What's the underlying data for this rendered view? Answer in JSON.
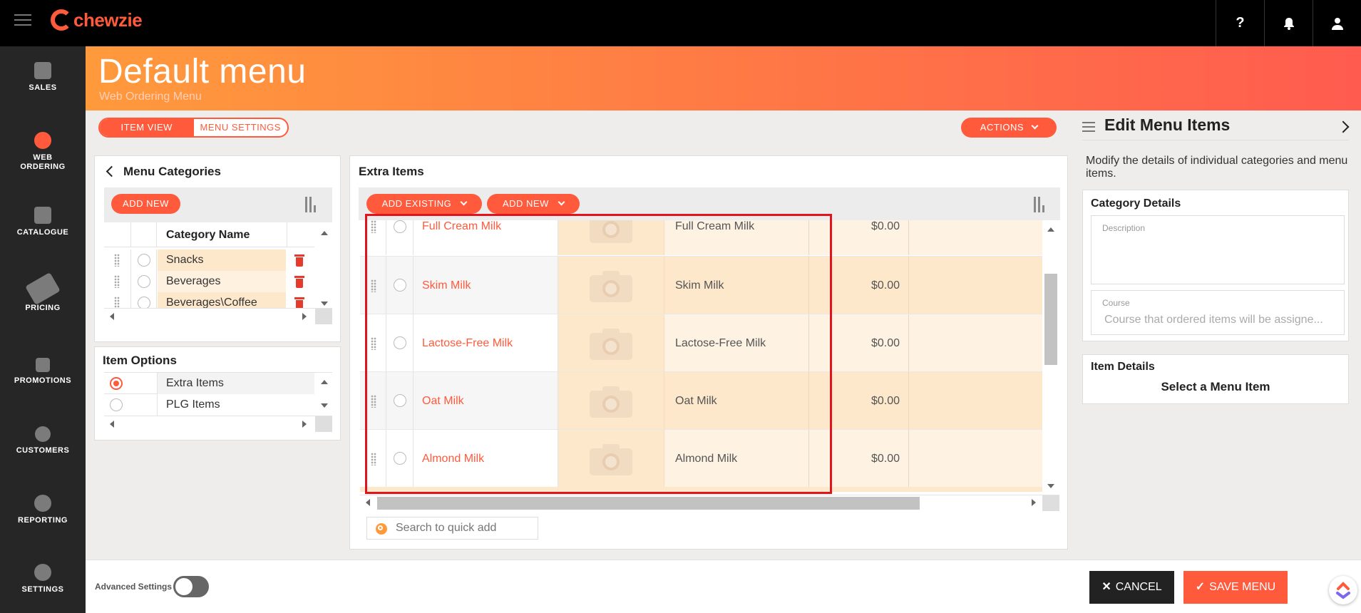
{
  "app": {
    "logo_text": "chewzie"
  },
  "topbar": {
    "help_icon": "?",
    "bell_icon": "bell-icon",
    "user_icon": "user-icon"
  },
  "nav": {
    "items": [
      {
        "label": "SALES",
        "icon": "sales-icon"
      },
      {
        "label": "WEB ORDERING",
        "icon": "globe-icon"
      },
      {
        "label": "CATALOGUE",
        "icon": "book-icon"
      },
      {
        "label": "PRICING",
        "icon": "tag-icon"
      },
      {
        "label": "PROMOTIONS",
        "icon": "megaphone-icon"
      },
      {
        "label": "CUSTOMERS",
        "icon": "users-icon"
      },
      {
        "label": "REPORTING",
        "icon": "pie-chart-icon"
      },
      {
        "label": "SETTINGS",
        "icon": "gear-icon"
      }
    ]
  },
  "banner": {
    "title": "Default menu",
    "subtitle": "Web Ordering Menu"
  },
  "view_toggle": {
    "item_view": "ITEM VIEW",
    "menu_settings": "MENU SETTINGS"
  },
  "actions_label": "ACTIONS",
  "categories": {
    "title": "Menu Categories",
    "add_new": "ADD NEW",
    "column_header": "Category Name",
    "rows": [
      "Snacks",
      "Beverages",
      "Beverages\\Coffee"
    ]
  },
  "item_options": {
    "title": "Item Options",
    "rows": [
      "Extra Items",
      "PLG Items"
    ],
    "selected": "Extra Items"
  },
  "items_panel": {
    "title": "Extra Items",
    "add_existing": "ADD EXISTING",
    "add_new": "ADD NEW",
    "rows": [
      {
        "name": "Full Cream Milk",
        "label": "Full Cream Milk",
        "price": "$0.00"
      },
      {
        "name": "Skim Milk",
        "label": "Skim Milk",
        "price": "$0.00"
      },
      {
        "name": "Lactose-Free Milk",
        "label": "Lactose-Free Milk",
        "price": "$0.00"
      },
      {
        "name": "Oat Milk",
        "label": "Oat Milk",
        "price": "$0.00"
      },
      {
        "name": "Almond Milk",
        "label": "Almond Milk",
        "price": "$0.00"
      }
    ],
    "search_placeholder": "Search to quick add"
  },
  "edit_panel": {
    "title": "Edit Menu Items",
    "description": "Modify the details of individual categories and menu items.",
    "category_details": {
      "title": "Category Details",
      "description_label": "Description",
      "course_label": "Course",
      "course_placeholder": "Course that ordered items will be assigne..."
    },
    "item_details": {
      "title": "Item Details",
      "empty_text": "Select a Menu Item"
    }
  },
  "bottom": {
    "advanced_settings": "Advanced Settings",
    "cancel": "CANCEL",
    "save": "SAVE MENU"
  },
  "colors": {
    "accent": "#ff5a3c",
    "highlight_box": "#e3131b",
    "row_highlight": "#fde8cc"
  }
}
